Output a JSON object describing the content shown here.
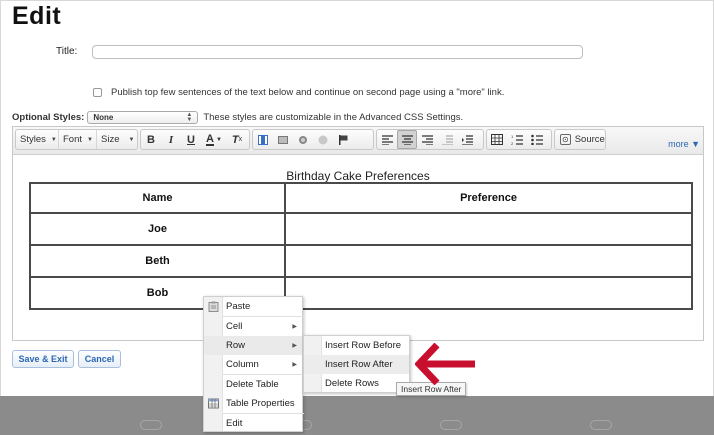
{
  "page": {
    "title": "Edit"
  },
  "form": {
    "title_label": "Title:",
    "title_value": "",
    "publish_text": "Publish top few sentences of the text below and continue on second page using a \"more\" link.",
    "optional_styles_label": "Optional Styles:",
    "optional_styles_value": "None",
    "optional_styles_hint": "These styles are customizable in the Advanced CSS Settings."
  },
  "toolbar": {
    "styles_label": "Styles",
    "font_label": "Font",
    "size_label": "Size",
    "bold_label": "B",
    "italic_label": "I",
    "underline_label": "U",
    "text_color_label": "A",
    "remove_format_label": "T",
    "source_label": "Source",
    "more_label": "more ▼"
  },
  "table": {
    "caption": "Birthday Cake Preferences",
    "headers": [
      "Name",
      "Preference"
    ],
    "rows": [
      [
        "Joe",
        ""
      ],
      [
        "Beth",
        ""
      ],
      [
        "Bob",
        ""
      ]
    ]
  },
  "buttons": {
    "save_exit": "Save & Exit",
    "cancel": "Cancel"
  },
  "context_menu": {
    "items": [
      {
        "label": "Paste",
        "icon": "clipboard-icon",
        "submenu": false
      },
      {
        "label": "Cell",
        "submenu": true
      },
      {
        "label": "Row",
        "submenu": true,
        "highlighted": true
      },
      {
        "label": "Column",
        "submenu": true
      },
      {
        "label": "Delete Table",
        "submenu": false
      },
      {
        "label": "Table Properties",
        "icon": "table-icon",
        "submenu": false
      },
      {
        "label": "Edit",
        "submenu": false
      }
    ]
  },
  "row_submenu": {
    "items": [
      {
        "label": "Insert Row Before"
      },
      {
        "label": "Insert Row After",
        "highlighted": true
      },
      {
        "label": "Delete Rows"
      }
    ]
  },
  "tooltip": {
    "text": "Insert Row After"
  },
  "colors": {
    "accent_link": "#2c67b4",
    "annotation_arrow": "#c8102e",
    "footer_bg": "#8b8b8b"
  }
}
